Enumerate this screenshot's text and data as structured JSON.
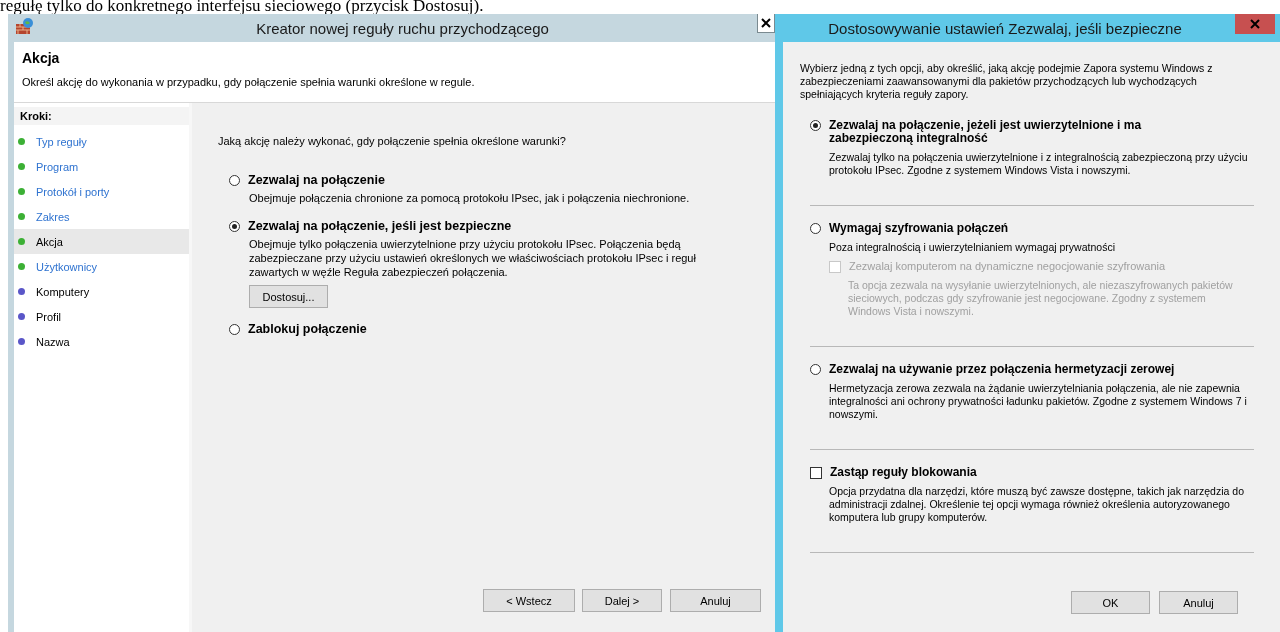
{
  "background_text": "regułę tylko do konkretnego interfejsu sieciowego (przycisk Dostosuj).",
  "wizard": {
    "title": "Kreator nowej reguły ruchu przychodzącego",
    "header": {
      "title": "Akcja",
      "description": "Określ akcję do wykonania w przypadku, gdy połączenie spełnia warunki określone w regule."
    },
    "steps_heading": "Kroki:",
    "steps": [
      {
        "label": "Typ reguły",
        "color": "#3cb035",
        "link": true,
        "selected": false
      },
      {
        "label": "Program",
        "color": "#3cb035",
        "link": true,
        "selected": false
      },
      {
        "label": "Protokół i porty",
        "color": "#3cb035",
        "link": true,
        "selected": false
      },
      {
        "label": "Zakres",
        "color": "#3cb035",
        "link": true,
        "selected": false
      },
      {
        "label": "Akcja",
        "color": "#3cb035",
        "link": false,
        "selected": true
      },
      {
        "label": "Użytkownicy",
        "color": "#3cb035",
        "link": true,
        "selected": false
      },
      {
        "label": "Komputery",
        "color": "#5a56c8",
        "link": false,
        "selected": false
      },
      {
        "label": "Profil",
        "color": "#5a56c8",
        "link": false,
        "selected": false
      },
      {
        "label": "Nazwa",
        "color": "#5a56c8",
        "link": false,
        "selected": false
      }
    ],
    "question": "Jaką akcję należy wykonać, gdy połączenie spełnia określone warunki?",
    "options": [
      {
        "label": "Zezwalaj na połączenie",
        "selected": false,
        "description": "Obejmuje połączenia chronione za pomocą protokołu IPsec, jak i połączenia niechronione."
      },
      {
        "label": "Zezwalaj na połączenie, jeśli jest bezpieczne",
        "selected": true,
        "description": "Obejmuje tylko połączenia uwierzytelnione przy użyciu protokołu IPsec. Połączenia będą zabezpieczane przy użyciu ustawień określonych we właściwościach protokołu IPsec i reguł zawartych w węźle Reguła zabezpieczeń połączenia.",
        "button": "Dostosuj..."
      },
      {
        "label": "Zablokuj połączenie",
        "selected": false
      }
    ],
    "buttons": [
      "< Wstecz",
      "Dalej >",
      "Anuluj"
    ]
  },
  "dialog": {
    "title": "Dostosowywanie ustawień Zezwalaj, jeśli bezpieczne",
    "intro": "Wybierz jedną z tych opcji, aby określić, jaką akcję podejmie Zapora systemu Windows z zabezpieczeniami zaawansowanymi dla pakietów przychodzących lub wychodzących spełniających kryteria reguły zapory.",
    "sections": [
      {
        "kind": "radio",
        "label": "Zezwalaj na połączenie, jeżeli jest uwierzytelnione i ma zabezpieczoną integralność",
        "selected": true,
        "description": "Zezwalaj tylko na połączenia uwierzytelnione i z integralnością zabezpieczoną przy użyciu protokołu IPsec. Zgodne z systemem Windows Vista i nowszymi."
      },
      {
        "kind": "radio",
        "label": "Wymagaj szyfrowania połączeń",
        "selected": false,
        "description": "Poza integralnością i uwierzytelnianiem wymagaj prywatności",
        "sub_option": {
          "label": "Zezwalaj komputerom na dynamiczne negocjowanie szyfrowania",
          "checked": false,
          "disabled": true,
          "description": "Ta opcja zezwala na wysyłanie uwierzytelnionych, ale niezaszyfrowanych pakietów sieciowych, podczas gdy szyfrowanie jest negocjowane. Zgodny z systemem Windows Vista i nowszymi."
        }
      },
      {
        "kind": "radio",
        "label": "Zezwalaj na używanie przez połączenia hermetyzacji zerowej",
        "selected": false,
        "description": "Hermetyzacja zerowa zezwala na żądanie uwierzytelniania połączenia, ale nie zapewnia integralności ani ochrony prywatności ładunku pakietów. Zgodne z systemem Windows 7 i nowszymi."
      },
      {
        "kind": "checkbox",
        "label": "Zastąp reguły blokowania",
        "checked": false,
        "description": "Opcja przydatna dla narzędzi, które muszą być zawsze dostępne, takich jak narzędzia do administracji zdalnej. Określenie tej opcji wymaga również określenia autoryzowanego komputera lub grupy komputerów."
      }
    ],
    "buttons": [
      "OK",
      "Anuluj"
    ]
  }
}
